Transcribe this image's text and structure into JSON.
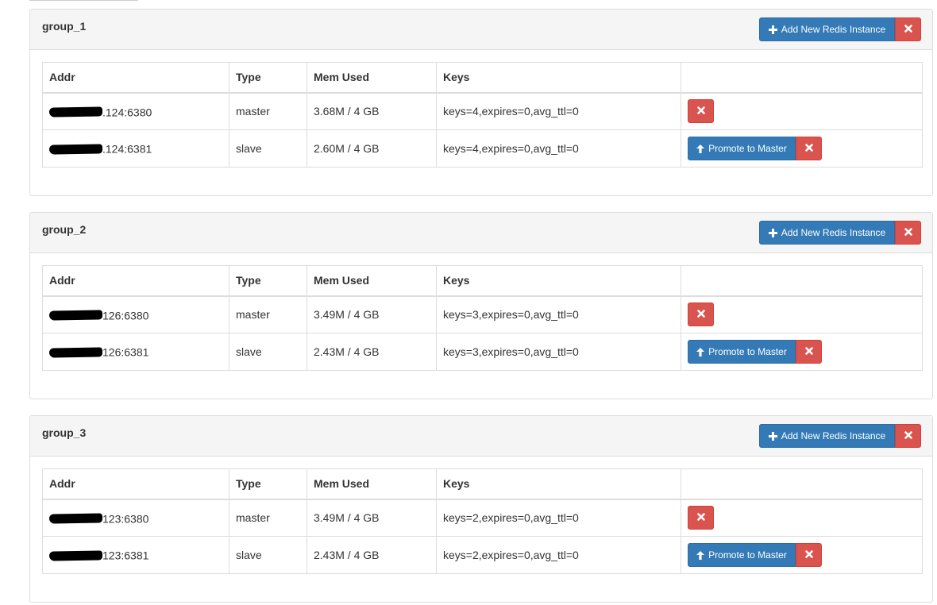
{
  "columns": {
    "addr": "Addr",
    "type": "Type",
    "mem": "Mem Used",
    "keys": "Keys",
    "actions": ""
  },
  "add_label": "Add New Redis Instance",
  "promote_label": "Promote to Master",
  "colors": {
    "primary": "#337ab7",
    "danger": "#d9534f",
    "heading_bg": "#f5f5f5",
    "border": "#ddd"
  },
  "icons": {
    "add": "plus-icon",
    "remove": "times-icon",
    "promote": "arrow-up-icon"
  },
  "groups": [
    {
      "title": "group_1",
      "rows": [
        {
          "addr_suffix": ".124:6380",
          "type": "master",
          "mem": "3.68M / 4 GB",
          "keys": "keys=4,expires=0,avg_ttl=0"
        },
        {
          "addr_suffix": ".124:6381",
          "type": "slave",
          "mem": "2.60M / 4 GB",
          "keys": "keys=4,expires=0,avg_ttl=0"
        }
      ]
    },
    {
      "title": "group_2",
      "rows": [
        {
          "addr_suffix": "126:6380",
          "type": "master",
          "mem": "3.49M / 4 GB",
          "keys": "keys=3,expires=0,avg_ttl=0"
        },
        {
          "addr_suffix": "126:6381",
          "type": "slave",
          "mem": "2.43M / 4 GB",
          "keys": "keys=3,expires=0,avg_ttl=0"
        }
      ]
    },
    {
      "title": "group_3",
      "rows": [
        {
          "addr_suffix": "123:6380",
          "type": "master",
          "mem": "3.49M / 4 GB",
          "keys": "keys=2,expires=0,avg_ttl=0"
        },
        {
          "addr_suffix": "123:6381",
          "type": "slave",
          "mem": "2.43M / 4 GB",
          "keys": "keys=2,expires=0,avg_ttl=0"
        }
      ]
    }
  ]
}
